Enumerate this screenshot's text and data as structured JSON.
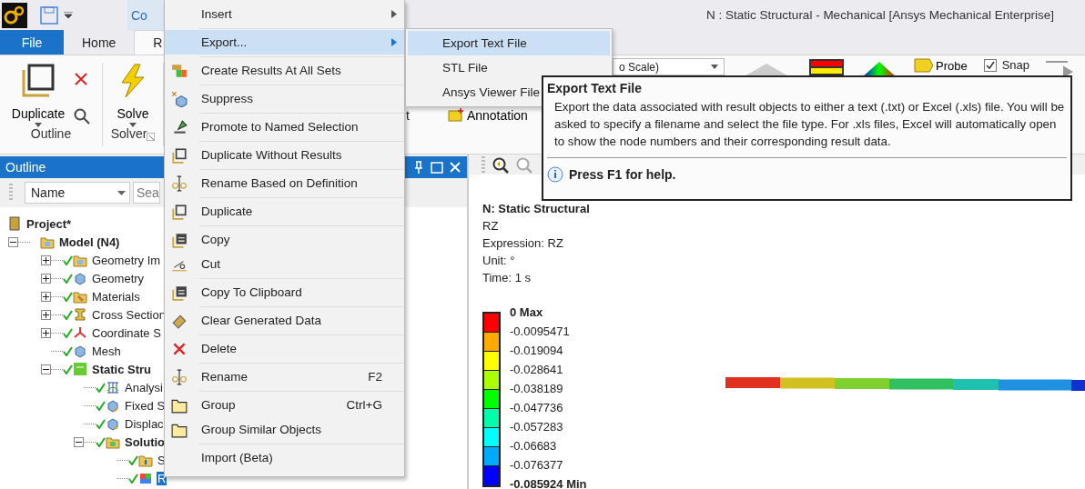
{
  "title_bar": {
    "tab": "Co",
    "title": "N : Static Structural - Mechanical [Ansys Mechanical Enterprise]"
  },
  "ribbon": {
    "tabs": [
      {
        "label": "File",
        "kind": "file",
        "selected": false
      },
      {
        "label": "Home",
        "kind": "tab",
        "selected": false
      },
      {
        "label": "R",
        "kind": "tab",
        "selected": true
      }
    ],
    "groups": [
      {
        "label": "Outline",
        "button": "Duplicate",
        "kind": "duplicate"
      },
      {
        "label": "Solver",
        "button": "Solve",
        "kind": "solve"
      }
    ],
    "partial_text": "t",
    "annotation": "Annotation",
    "scale_dropdown": "o Scale)",
    "probe": "Probe",
    "snap": {
      "label": "Snap",
      "checked": true
    }
  },
  "outline": {
    "title": "Outline",
    "column_dropdown": "Name",
    "search": {
      "placeholder": "Sea"
    },
    "tree": [
      {
        "label": "Project*",
        "kind": "project",
        "selected": false,
        "children": [
          {
            "label": "Model (N4)",
            "kind": "model",
            "selected": false,
            "expanded": true,
            "children": [
              {
                "label": "Geometry Im",
                "kind": "geometry_import",
                "selected": false,
                "expanded": false,
                "solved": true
              },
              {
                "label": "Geometry",
                "kind": "geometry",
                "selected": false,
                "expanded": false,
                "solved": true
              },
              {
                "label": "Materials",
                "kind": "materials",
                "selected": false,
                "expanded": false,
                "solved": true
              },
              {
                "label": "Cross Section",
                "kind": "cross_sections",
                "selected": false,
                "expanded": false,
                "solved": true
              },
              {
                "label": "Coordinate S",
                "kind": "coordinates",
                "selected": false,
                "expanded": false,
                "solved": true
              },
              {
                "label": "Mesh",
                "kind": "mesh",
                "selected": false,
                "solved": true
              },
              {
                "label": "Static Stru",
                "kind": "environment",
                "selected": false,
                "expanded": true,
                "solved": true,
                "children": [
                  {
                    "label": "Analysi",
                    "kind": "analysis",
                    "selected": false,
                    "solved": true
                  },
                  {
                    "label": "Fixed S",
                    "kind": "support",
                    "selected": false,
                    "solved": true
                  },
                  {
                    "label": "Displac",
                    "kind": "displacement",
                    "selected": false,
                    "solved": true
                  },
                  {
                    "label": "Solutio",
                    "kind": "solution",
                    "selected": false,
                    "expanded": true,
                    "solved": true,
                    "children": [
                      {
                        "label": "S",
                        "kind": "info",
                        "selected": false,
                        "solved": true
                      },
                      {
                        "label": "R",
                        "kind": "result",
                        "selected": true,
                        "solved": true
                      }
                    ]
                  }
                ]
              }
            ]
          }
        ]
      }
    ]
  },
  "context_menu": {
    "groups": [
      [
        {
          "label": "Insert",
          "kind": "none",
          "submenu": true,
          "selected": false
        }
      ],
      [
        {
          "label": "Export...",
          "kind": "none",
          "submenu": true,
          "selected": true
        }
      ],
      [
        {
          "label": "Create Results At All Sets",
          "kind": "results",
          "selected": false
        }
      ],
      [
        {
          "label": "Suppress",
          "kind": "suppress",
          "selected": false
        }
      ],
      [
        {
          "label": "Promote to Named Selection",
          "kind": "promote",
          "selected": false
        }
      ],
      [
        {
          "label": "Duplicate Without Results",
          "kind": "duplicate",
          "selected": false
        }
      ],
      [
        {
          "label": "Rename Based on Definition",
          "kind": "rename",
          "selected": false
        }
      ],
      [
        {
          "label": "Duplicate",
          "kind": "duplicate",
          "selected": false
        }
      ],
      [
        {
          "label": "Copy",
          "kind": "copy",
          "selected": false
        },
        {
          "label": "Cut",
          "kind": "cut",
          "selected": false
        }
      ],
      [
        {
          "label": "Copy To Clipboard",
          "kind": "copy",
          "selected": false
        }
      ],
      [
        {
          "label": "Clear Generated Data",
          "kind": "eraser",
          "selected": false
        }
      ],
      [
        {
          "label": "Delete",
          "kind": "delete",
          "selected": false
        }
      ],
      [
        {
          "label": "Rename",
          "kind": "rename",
          "shortcut": "F2",
          "selected": false
        }
      ],
      [
        {
          "label": "Group",
          "kind": "folder",
          "shortcut": "Ctrl+G",
          "selected": false
        },
        {
          "label": "Group Similar Objects",
          "kind": "folder",
          "selected": false
        }
      ],
      [
        {
          "label": "Import (Beta)",
          "kind": "none",
          "selected": false
        }
      ]
    ]
  },
  "submenu": {
    "items": [
      {
        "label": "Export Text File",
        "selected": true
      },
      {
        "label": "STL File",
        "selected": false
      },
      {
        "label": "Ansys Viewer File",
        "selected": false
      }
    ]
  },
  "tooltip": {
    "title": "Export Text File",
    "body": "Export the data associated with result objects to either a text (.txt) or Excel (.xls) file. You will be asked to specify a filename and select the file type. For .xls files, Excel will automatically open to show the node numbers and their corresponding result data.",
    "help": "Press F1 for help."
  },
  "graphics": {
    "info": [
      "N: Static Structural",
      "RZ",
      "Expression: RZ",
      "Unit: °",
      "Time: 1 s"
    ],
    "legend": {
      "bands": [
        {
          "color": "#ff0000"
        },
        {
          "color": "#ffaa00"
        },
        {
          "color": "#ffff00"
        },
        {
          "color": "#aaff00"
        },
        {
          "color": "#00ff00"
        },
        {
          "color": "#00ffaa"
        },
        {
          "color": "#00ffff"
        },
        {
          "color": "#00aaff"
        },
        {
          "color": "#0000ff"
        }
      ],
      "labels": [
        "0 Max",
        "-0.0095471",
        "-0.019094",
        "-0.028641",
        "-0.038189",
        "-0.047736",
        "-0.057283",
        "-0.06683",
        "-0.076377",
        "-0.085924 Min"
      ]
    }
  }
}
